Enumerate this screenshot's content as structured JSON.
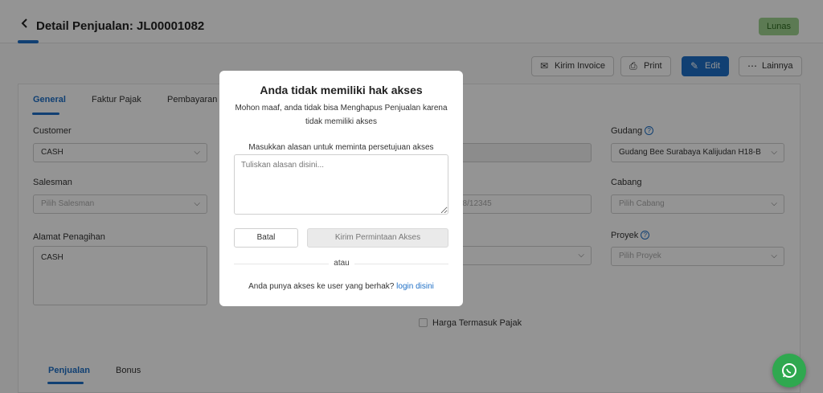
{
  "header": {
    "title": "Detail Penjualan: JL00001082",
    "status_badge": "Lunas"
  },
  "toolbar": {
    "send_invoice": "Kirim Invoice",
    "print": "Print",
    "edit": "Edit",
    "more": "Lainnya"
  },
  "tabs": [
    "General",
    "Faktur Pajak",
    "Pembayaran"
  ],
  "form": {
    "customer_label": "Customer",
    "customer_value": "CASH",
    "salesman_label": "Salesman",
    "salesman_placeholder": "Pilih Salesman",
    "billing_address_label": "Alamat Penagihan",
    "billing_address_value": "CASH",
    "col3_value_1": "2",
    "col3_value_2": "08/12345",
    "warehouse_label": "Gudang",
    "warehouse_value": "Gudang Bee Surabaya Kalijudan H18-B",
    "branch_label": "Cabang",
    "branch_placeholder": "Pilih Cabang",
    "project_label": "Proyek",
    "project_placeholder": "Pilih Proyek",
    "tax_inclusive_label": "Harga Termasuk Pajak"
  },
  "bottom_tabs": [
    "Penjualan",
    "Bonus"
  ],
  "modal": {
    "title": "Anda tidak memiliki hak akses",
    "description": "Mohon maaf, anda tidak bisa Menghapus Penjualan karena tidak memiliki akses",
    "reason_label": "Masukkan alasan untuk meminta persetujuan akses",
    "reason_placeholder": "Tuliskan alasan disini...",
    "cancel": "Batal",
    "request": "Kirim Permintaan Akses",
    "or": "atau",
    "footer_text": "Anda punya akses ke user yang berhak?",
    "login_link": "login disini"
  },
  "colors": {
    "primary": "#1e6fc6",
    "status_badge": "#9fd38f",
    "whatsapp": "#2fa84f"
  }
}
